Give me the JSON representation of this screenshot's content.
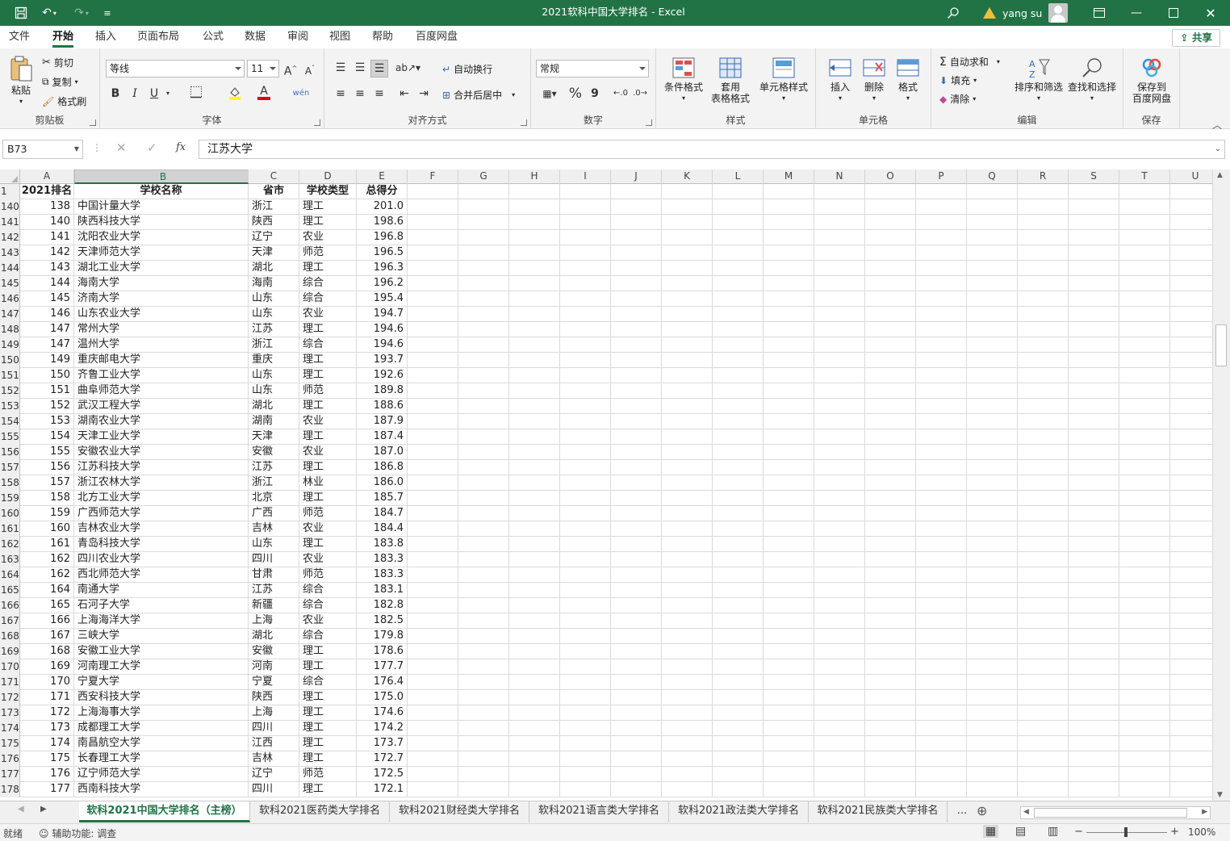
{
  "window": {
    "title": "2021软科中国大学排名  -  Excel",
    "user": "yang su"
  },
  "ribbon_tabs": [
    "文件",
    "开始",
    "插入",
    "页面布局",
    "公式",
    "数据",
    "审阅",
    "视图",
    "帮助",
    "百度网盘"
  ],
  "share_label": "共享",
  "ribbon": {
    "clipboard": {
      "paste": "粘贴",
      "cut": "剪切",
      "copy": "复制",
      "format_painter": "格式刷",
      "label": "剪贴板"
    },
    "font": {
      "name": "等线",
      "size": "11",
      "bold": "B",
      "italic": "I",
      "underline": "U",
      "grow": "A",
      "shrink": "A",
      "font_color": "A",
      "label": "字体"
    },
    "alignment": {
      "wrap": "自动换行",
      "merge": "合并后居中",
      "label": "对齐方式"
    },
    "number": {
      "format": "常规",
      "percent": "%",
      "comma": "9",
      "label": "数字"
    },
    "styles": {
      "conditional": "条件格式",
      "table": "套用\n表格格式",
      "cell_styles": "单元格样式",
      "label": "样式"
    },
    "cells": {
      "insert": "插入",
      "delete": "删除",
      "format": "格式",
      "label": "单元格"
    },
    "editing": {
      "autosum": "自动求和",
      "fill": "填充",
      "clear": "清除",
      "sort": "排序和筛选",
      "find": "查找和选择",
      "label": "编辑"
    },
    "save": {
      "baidu": "保存到\n百度网盘",
      "label": "保存"
    }
  },
  "name_box": "B73",
  "fx": "fx",
  "formula": "江苏大学",
  "columns": [
    "A",
    "B",
    "C",
    "D",
    "E",
    "F",
    "G",
    "H",
    "I",
    "J",
    "K",
    "L",
    "M",
    "N",
    "O",
    "P",
    "Q",
    "R",
    "S",
    "T",
    "U"
  ],
  "header_row": {
    "row": "1",
    "cells": [
      "2021排名",
      "学校名称",
      "省市",
      "学校类型",
      "总得分"
    ]
  },
  "rows": [
    {
      "r": "140",
      "a": "138",
      "b": "中国计量大学",
      "c": "浙江",
      "d": "理工",
      "e": "201.0"
    },
    {
      "r": "141",
      "a": "140",
      "b": "陕西科技大学",
      "c": "陕西",
      "d": "理工",
      "e": "198.6"
    },
    {
      "r": "142",
      "a": "141",
      "b": "沈阳农业大学",
      "c": "辽宁",
      "d": "农业",
      "e": "196.8"
    },
    {
      "r": "143",
      "a": "142",
      "b": "天津师范大学",
      "c": "天津",
      "d": "师范",
      "e": "196.5"
    },
    {
      "r": "144",
      "a": "143",
      "b": "湖北工业大学",
      "c": "湖北",
      "d": "理工",
      "e": "196.3"
    },
    {
      "r": "145",
      "a": "144",
      "b": "海南大学",
      "c": "海南",
      "d": "综合",
      "e": "196.2"
    },
    {
      "r": "146",
      "a": "145",
      "b": "济南大学",
      "c": "山东",
      "d": "综合",
      "e": "195.4"
    },
    {
      "r": "147",
      "a": "146",
      "b": "山东农业大学",
      "c": "山东",
      "d": "农业",
      "e": "194.7"
    },
    {
      "r": "148",
      "a": "147",
      "b": "常州大学",
      "c": "江苏",
      "d": "理工",
      "e": "194.6"
    },
    {
      "r": "149",
      "a": "147",
      "b": "温州大学",
      "c": "浙江",
      "d": "综合",
      "e": "194.6"
    },
    {
      "r": "150",
      "a": "149",
      "b": "重庆邮电大学",
      "c": "重庆",
      "d": "理工",
      "e": "193.7"
    },
    {
      "r": "151",
      "a": "150",
      "b": "齐鲁工业大学",
      "c": "山东",
      "d": "理工",
      "e": "192.6"
    },
    {
      "r": "152",
      "a": "151",
      "b": "曲阜师范大学",
      "c": "山东",
      "d": "师范",
      "e": "189.8"
    },
    {
      "r": "153",
      "a": "152",
      "b": "武汉工程大学",
      "c": "湖北",
      "d": "理工",
      "e": "188.6"
    },
    {
      "r": "154",
      "a": "153",
      "b": "湖南农业大学",
      "c": "湖南",
      "d": "农业",
      "e": "187.9"
    },
    {
      "r": "155",
      "a": "154",
      "b": "天津工业大学",
      "c": "天津",
      "d": "理工",
      "e": "187.4"
    },
    {
      "r": "156",
      "a": "155",
      "b": "安徽农业大学",
      "c": "安徽",
      "d": "农业",
      "e": "187.0"
    },
    {
      "r": "157",
      "a": "156",
      "b": "江苏科技大学",
      "c": "江苏",
      "d": "理工",
      "e": "186.8"
    },
    {
      "r": "158",
      "a": "157",
      "b": "浙江农林大学",
      "c": "浙江",
      "d": "林业",
      "e": "186.0"
    },
    {
      "r": "159",
      "a": "158",
      "b": "北方工业大学",
      "c": "北京",
      "d": "理工",
      "e": "185.7"
    },
    {
      "r": "160",
      "a": "159",
      "b": "广西师范大学",
      "c": "广西",
      "d": "师范",
      "e": "184.7"
    },
    {
      "r": "161",
      "a": "160",
      "b": "吉林农业大学",
      "c": "吉林",
      "d": "农业",
      "e": "184.4"
    },
    {
      "r": "162",
      "a": "161",
      "b": "青岛科技大学",
      "c": "山东",
      "d": "理工",
      "e": "183.8"
    },
    {
      "r": "163",
      "a": "162",
      "b": "四川农业大学",
      "c": "四川",
      "d": "农业",
      "e": "183.3"
    },
    {
      "r": "164",
      "a": "162",
      "b": "西北师范大学",
      "c": "甘肃",
      "d": "师范",
      "e": "183.3"
    },
    {
      "r": "165",
      "a": "164",
      "b": "南通大学",
      "c": "江苏",
      "d": "综合",
      "e": "183.1"
    },
    {
      "r": "166",
      "a": "165",
      "b": "石河子大学",
      "c": "新疆",
      "d": "综合",
      "e": "182.8"
    },
    {
      "r": "167",
      "a": "166",
      "b": "上海海洋大学",
      "c": "上海",
      "d": "农业",
      "e": "182.5"
    },
    {
      "r": "168",
      "a": "167",
      "b": "三峡大学",
      "c": "湖北",
      "d": "综合",
      "e": "179.8"
    },
    {
      "r": "169",
      "a": "168",
      "b": "安徽工业大学",
      "c": "安徽",
      "d": "理工",
      "e": "178.6"
    },
    {
      "r": "170",
      "a": "169",
      "b": "河南理工大学",
      "c": "河南",
      "d": "理工",
      "e": "177.7"
    },
    {
      "r": "171",
      "a": "170",
      "b": "宁夏大学",
      "c": "宁夏",
      "d": "综合",
      "e": "176.4"
    },
    {
      "r": "172",
      "a": "171",
      "b": "西安科技大学",
      "c": "陕西",
      "d": "理工",
      "e": "175.0"
    },
    {
      "r": "173",
      "a": "172",
      "b": "上海海事大学",
      "c": "上海",
      "d": "理工",
      "e": "174.6"
    },
    {
      "r": "174",
      "a": "173",
      "b": "成都理工大学",
      "c": "四川",
      "d": "理工",
      "e": "174.2"
    },
    {
      "r": "175",
      "a": "174",
      "b": "南昌航空大学",
      "c": "江西",
      "d": "理工",
      "e": "173.7"
    },
    {
      "r": "176",
      "a": "175",
      "b": "长春理工大学",
      "c": "吉林",
      "d": "理工",
      "e": "172.7"
    },
    {
      "r": "177",
      "a": "176",
      "b": "辽宁师范大学",
      "c": "辽宁",
      "d": "师范",
      "e": "172.5"
    },
    {
      "r": "178",
      "a": "177",
      "b": "西南科技大学",
      "c": "四川",
      "d": "理工",
      "e": "172.1"
    }
  ],
  "sheet_tabs": [
    "软科2021中国大学排名（主榜）",
    "软科2021医药类大学排名",
    "软科2021财经类大学排名",
    "软科2021语言类大学排名",
    "软科2021政法类大学排名",
    "软科2021民族类大学排名"
  ],
  "sheet_more": "...",
  "status": {
    "ready": "就绪",
    "accessibility": "辅助功能: 调查",
    "zoom": "100%"
  },
  "colors": {
    "accent": "#217346"
  }
}
